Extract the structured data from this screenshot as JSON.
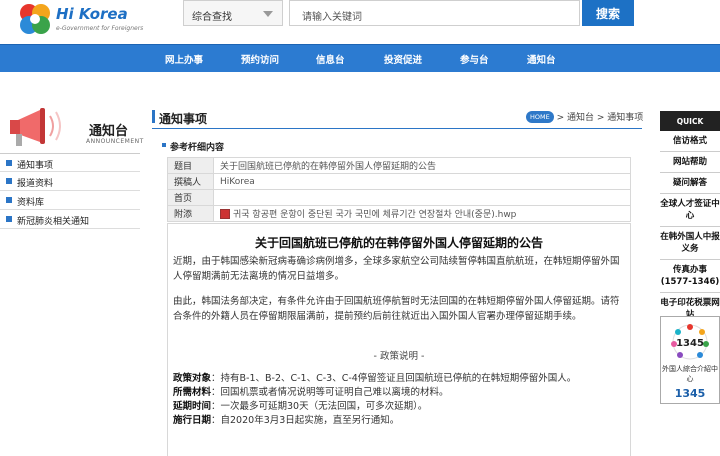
{
  "header": {
    "logo_text": "Hi Korea",
    "logo_sub": "e-Government for Foreigners",
    "search_scope": "综合查找",
    "search_placeholder": "请输入关键词",
    "search_button": "搜索"
  },
  "nav": [
    "网上办事",
    "预约访问",
    "信息台",
    "投资促进",
    "参与台",
    "通知台"
  ],
  "sidebar": {
    "title": "通知台",
    "subtitle": "ANNOUNCEMENT",
    "items": [
      "通知事项",
      "报道资料",
      "资料库",
      "新冠肺炎相关通知"
    ]
  },
  "main": {
    "page_title": "通知事项",
    "breadcrumb_home": "HOME",
    "breadcrumb_rest": "> 通知台 > 通知事项",
    "ref_label": "参考杆细内容",
    "table": [
      {
        "key": "题目",
        "value": "关于回国航班已停航的在韩停留外国人停留延期的公告"
      },
      {
        "key": "撰稿人",
        "value": "HiKorea"
      },
      {
        "key": "首页",
        "value": ""
      },
      {
        "key": "附添",
        "value": "귀국 항공편 운항이 중단된 국가 국민에 체류기간 연장절차 안내(중문).hwp"
      }
    ],
    "article": {
      "title": "关于回国航班已停航的在韩停留外国人停留延期的公告",
      "p1": "近期，由于韩国感染新冠病毒确诊病例增多，全球多家航空公司陆续暂停韩国直航航班，在韩短期停留外国人停留期满前无法离境的情况日益增多。",
      "p2": "由此，韩国法务部决定，有条件允许由于回国航班停航暂时无法回国的在韩短期停留外国人停留延期。请符合条件的外籍人员在停留期限届满前，提前预约后前往就近出入国外国人官署办理停留延期手续。",
      "section": "- 政策说明 -",
      "rows": [
        {
          "label": "政策对象",
          "text": "：持有B-1、B-2、C-1、C-3、C-4停留签证且回国航班已停航的在韩短期停留外国人。"
        },
        {
          "label": "所需材料",
          "text": "：回国机票或者情况说明等可证明自己难以离境的材料。"
        },
        {
          "label": "延期时间",
          "text": "：一次最多可延期30天（无法回国，可多次延期）。"
        },
        {
          "label": "施行日期",
          "text": "：自2020年3月3日起实施，直至另行通知。"
        }
      ]
    }
  },
  "quick": {
    "head": "QUICK",
    "items": [
      "信访格式",
      "网站帮助",
      "疑问解答",
      "全球人才签证中心",
      "在韩外国人中报义务",
      "传真办事 (1577-1346)",
      "电子印花税票网站"
    ],
    "box_number_top": "1345",
    "box_text": "外国人綜合介紹中心",
    "box_number": "1345"
  },
  "colors": {
    "brand_blue": "#2c7bd1",
    "accent_blue": "#1d71c5",
    "quick_head": "#222222"
  }
}
